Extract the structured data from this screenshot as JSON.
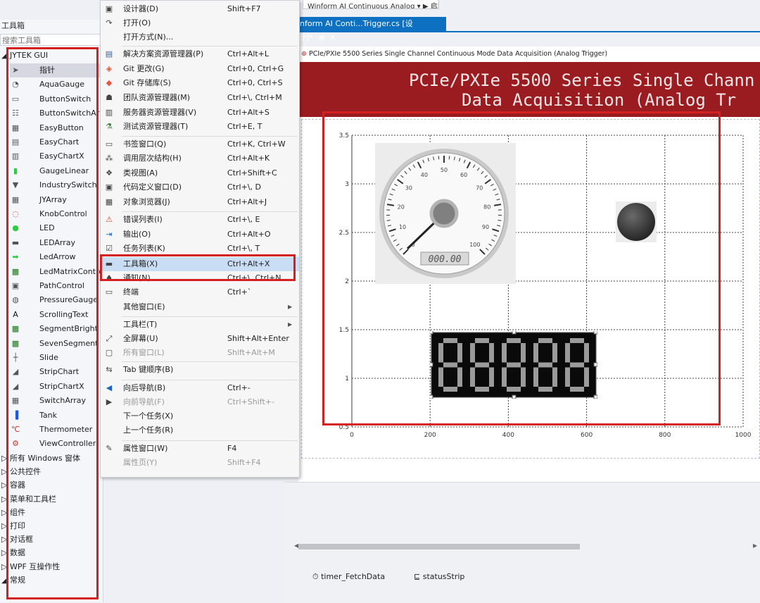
{
  "topbar": {
    "run_text": "Winform AI Continuous Analog ▾ ▶ 启动"
  },
  "toolbox": {
    "title": "工具箱",
    "search_placeholder": "搜索工具箱",
    "group_jytek": "◢ JYTEK GUI",
    "items": [
      {
        "label": "指针",
        "icon": "pointer-icon"
      },
      {
        "label": "AquaGauge",
        "icon": "aqua-gauge-icon"
      },
      {
        "label": "ButtonSwitch",
        "icon": "button-switch-icon"
      },
      {
        "label": "ButtonSwitchArray",
        "icon": "button-switch-array-icon"
      },
      {
        "label": "EasyButton",
        "icon": "easy-button-icon"
      },
      {
        "label": "EasyChart",
        "icon": "easy-chart-icon"
      },
      {
        "label": "EasyChartX",
        "icon": "easy-chartx-icon"
      },
      {
        "label": "GaugeLinear",
        "icon": "gauge-linear-icon"
      },
      {
        "label": "IndustrySwitch",
        "icon": "industry-switch-icon"
      },
      {
        "label": "JYArray",
        "icon": "jy-array-icon"
      },
      {
        "label": "KnobControl",
        "icon": "knob-icon"
      },
      {
        "label": "LED",
        "icon": "led-icon"
      },
      {
        "label": "LEDArray",
        "icon": "led-array-icon"
      },
      {
        "label": "LedArrow",
        "icon": "led-arrow-icon"
      },
      {
        "label": "LedMatrixControl",
        "icon": "led-matrix-icon"
      },
      {
        "label": "PathControl",
        "icon": "path-control-icon"
      },
      {
        "label": "PressureGauge",
        "icon": "pressure-gauge-icon"
      },
      {
        "label": "ScrollingText",
        "icon": "scrolling-text-icon"
      },
      {
        "label": "SegmentBright",
        "icon": "segment-bright-icon"
      },
      {
        "label": "SevenSegment",
        "icon": "seven-segment-icon"
      },
      {
        "label": "Slide",
        "icon": "slide-icon"
      },
      {
        "label": "StripChart",
        "icon": "strip-chart-icon"
      },
      {
        "label": "StripChartX",
        "icon": "strip-chartx-icon"
      },
      {
        "label": "SwitchArray",
        "icon": "switch-array-icon"
      },
      {
        "label": "Tank",
        "icon": "tank-icon"
      },
      {
        "label": "Thermometer",
        "icon": "thermometer-icon"
      },
      {
        "label": "ViewController",
        "icon": "view-controller-icon"
      }
    ],
    "groups": [
      "▷ 所有 Windows 窗体",
      "▷ 公共控件",
      "▷ 容器",
      "▷ 菜单和工具栏",
      "▷ 组件",
      "▷ 打印",
      "▷ 对话框",
      "▷ 数据",
      "▷ WPF 互操作性",
      "◢ 常规"
    ]
  },
  "menu": {
    "items": [
      {
        "label": "设计器(D)",
        "shortcut": "Shift+F7",
        "icon": "designer-icon"
      },
      {
        "label": "打开(O)",
        "shortcut": "",
        "icon": "open-icon"
      },
      {
        "label": "打开方式(N)...",
        "shortcut": "",
        "icon": ""
      },
      {
        "label": "解决方案资源管理器(P)",
        "shortcut": "Ctrl+Alt+L",
        "icon": "solution-explorer-icon"
      },
      {
        "label": "Git 更改(G)",
        "shortcut": "Ctrl+0, Ctrl+G",
        "icon": "git-changes-icon"
      },
      {
        "label": "Git 存储库(S)",
        "shortcut": "Ctrl+0, Ctrl+S",
        "icon": "git-repo-icon"
      },
      {
        "label": "团队资源管理器(M)",
        "shortcut": "Ctrl+\\, Ctrl+M",
        "icon": "team-explorer-icon"
      },
      {
        "label": "服务器资源管理器(V)",
        "shortcut": "Ctrl+Alt+S",
        "icon": "server-explorer-icon"
      },
      {
        "label": "测试资源管理器(T)",
        "shortcut": "Ctrl+E, T",
        "icon": "test-explorer-icon"
      },
      {
        "label": "书签窗口(Q)",
        "shortcut": "Ctrl+K, Ctrl+W",
        "icon": "bookmark-icon"
      },
      {
        "label": "调用层次结构(H)",
        "shortcut": "Ctrl+Alt+K",
        "icon": "call-hierarchy-icon"
      },
      {
        "label": "类视图(A)",
        "shortcut": "Ctrl+Shift+C",
        "icon": "class-view-icon"
      },
      {
        "label": "代码定义窗口(D)",
        "shortcut": "Ctrl+\\, D",
        "icon": "code-definition-icon"
      },
      {
        "label": "对象浏览器(J)",
        "shortcut": "Ctrl+Alt+J",
        "icon": "object-browser-icon"
      },
      {
        "label": "错误列表(I)",
        "shortcut": "Ctrl+\\, E",
        "icon": "error-list-icon"
      },
      {
        "label": "输出(O)",
        "shortcut": "Ctrl+Alt+O",
        "icon": "output-icon"
      },
      {
        "label": "任务列表(K)",
        "shortcut": "Ctrl+\\, T",
        "icon": "task-list-icon"
      },
      {
        "label": "工具箱(X)",
        "shortcut": "Ctrl+Alt+X",
        "icon": "toolbox-icon"
      },
      {
        "label": "通知(N)",
        "shortcut": "Ctrl+\\, Ctrl+N",
        "icon": "notification-icon"
      },
      {
        "label": "终端",
        "shortcut": "Ctrl+`",
        "icon": "terminal-icon"
      },
      {
        "label": "其他窗口(E)",
        "shortcut": "",
        "icon": ""
      },
      {
        "label": "工具栏(T)",
        "shortcut": "",
        "icon": ""
      },
      {
        "label": "全屏幕(U)",
        "shortcut": "Shift+Alt+Enter",
        "icon": "fullscreen-icon"
      },
      {
        "label": "所有窗口(L)",
        "shortcut": "Shift+Alt+M",
        "icon": "all-windows-icon"
      },
      {
        "label": "Tab 键顺序(B)",
        "shortcut": "",
        "icon": "tab-order-icon"
      },
      {
        "label": "向后导航(B)",
        "shortcut": "Ctrl+-",
        "icon": "navigate-back-icon"
      },
      {
        "label": "向前导航(F)",
        "shortcut": "Ctrl+Shift+-",
        "icon": "navigate-forward-icon"
      },
      {
        "label": "下一个任务(X)",
        "shortcut": "",
        "icon": ""
      },
      {
        "label": "上一个任务(R)",
        "shortcut": "",
        "icon": ""
      },
      {
        "label": "属性窗口(W)",
        "shortcut": "F4",
        "icon": "properties-icon"
      },
      {
        "label": "属性页(Y)",
        "shortcut": "Shift+F4",
        "icon": ""
      }
    ]
  },
  "designer": {
    "tab_label": "nform AI Conti...Trigger.cs [设计]*",
    "form_title": "PCIe/PXIe 5500 Series Single Channel Continuous Mode Data Acquisition (Analog Trigger)",
    "banner_line1": "PCIe/PXIe 5500 Series Single Chann",
    "banner_line2": "Data Acquisition (Analog Tr",
    "gauge_readout": "000.00",
    "gauge_ticks": [
      "0",
      "10",
      "20",
      "30",
      "40",
      "50",
      "60",
      "70",
      "80",
      "90",
      "100"
    ],
    "segment_text": "88888"
  },
  "components": {
    "timer": "timer_FetchData",
    "status": "statusStrip"
  },
  "colors": {
    "accent": "#0e70c0",
    "banner": "#9b1c20",
    "annotation": "#d42020",
    "menu_highlight": "#c9def5"
  },
  "chart_data": {
    "type": "line",
    "x_ticks": [
      "0",
      "200",
      "400",
      "600",
      "800",
      "1000"
    ],
    "y_ticks": [
      "0.5",
      "1",
      "1.5",
      "2",
      "2.5",
      "3",
      "3.5"
    ],
    "xlim": [
      0,
      1000
    ],
    "ylim": [
      0.5,
      3.5
    ],
    "grid": true,
    "series": []
  }
}
